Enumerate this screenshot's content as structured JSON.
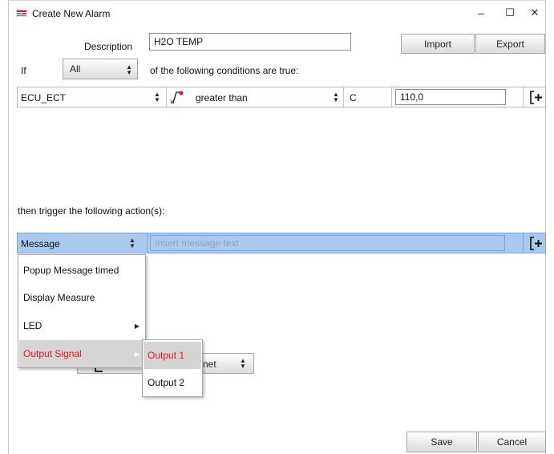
{
  "window": {
    "title": "Create New Alarm",
    "minimize": "–",
    "maximize": "☐",
    "close": "✕"
  },
  "header": {
    "description_label": "Description",
    "description_value": "H2O TEMP",
    "import_label": "Import",
    "export_label": "Export"
  },
  "condition_header": {
    "if_label": "If",
    "match_selected": "All",
    "suffix_text": "of the following conditions are true:"
  },
  "condition_row": {
    "channel": "ECU_ECT",
    "operator": "greater than",
    "unit": "C",
    "value": "110,0"
  },
  "actions": {
    "heading": "then trigger the following action(s):",
    "type_selected": "Message",
    "message_placeholder": "Insert message text"
  },
  "action_menu": {
    "items": [
      {
        "label": "Popup Message timed"
      },
      {
        "label": "Display Measure"
      },
      {
        "label": "LED"
      },
      {
        "label": "Output Signal"
      }
    ]
  },
  "output_submenu": {
    "items": [
      {
        "label": "Output 1"
      },
      {
        "label": "Output 2"
      }
    ]
  },
  "hidden_control": {
    "partial_text": "net"
  },
  "footer": {
    "save_label": "Save",
    "cancel_label": "Cancel"
  },
  "colors": {
    "selected_row_bg": "#a9c9f0",
    "active_menu_text": "#e8141e",
    "active_menu_bg": "#d5d5d5"
  }
}
